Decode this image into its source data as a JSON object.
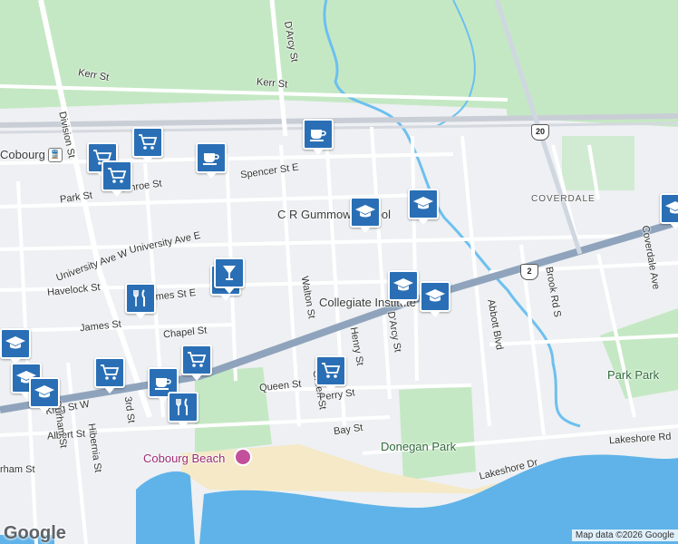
{
  "colors": {
    "water": "#5fb3e8",
    "park": "#c5e8c4",
    "road_major": "#8fa4bc",
    "pin": "#2a6fb5",
    "river": "#6cc0ef"
  },
  "labels": {
    "cobourg": "Cobourg",
    "kerr_st": "Kerr St",
    "darcy_st_n": "D'Arcy St",
    "division_st": "Division St",
    "spencer_st_e": "Spencer St E",
    "park_st": "Park St",
    "munroe_st": "Munroe St",
    "university_ave_e": "University Ave E",
    "university_ave_w": "University Ave W",
    "havelock_st": "Havelock St",
    "james_st_e": "James St E",
    "james_st": "James St",
    "chapel_st": "Chapel St",
    "walton_st": "Walton St",
    "henry_st": "Henry St",
    "darcy_st_s": "D'Arcy St",
    "abbott_blvd": "Abbott Blvd",
    "brook_rd_s": "Brook Rd S",
    "coverdale_ave": "Coverdale Ave",
    "coverdale": "COVERDALE",
    "queen_st": "Queen St",
    "green_st": "Green St",
    "perry_st": "Perry St",
    "bay_st": "Bay St",
    "king_st_w": "King St W",
    "albert_st": "Albert St",
    "third_st": "3rd St",
    "durham_st": "Durham St",
    "hibernia_st": "Hibernia St",
    "durham_st2": "rham St",
    "lakeshore_rd": "Lakeshore Rd",
    "lakeshore_dr": "Lakeshore Dr",
    "cr_gummow_school": "C R Gummow School",
    "collegiate_institute": "Collegiate Institute",
    "donegan_park": "Donegan Park",
    "park_park": "Park Park",
    "cobourg_beach": "Cobourg Beach",
    "route_2": "2",
    "route_20": "20",
    "google": "Google",
    "attribution": "Map data ©2026 Google"
  },
  "pins": [
    {
      "type": "cafe"
    },
    {
      "type": "grocery"
    },
    {
      "type": "grocery"
    },
    {
      "type": "grocery"
    },
    {
      "type": "cafe"
    },
    {
      "type": "school"
    },
    {
      "type": "school"
    },
    {
      "type": "school"
    },
    {
      "type": "school"
    },
    {
      "type": "school"
    },
    {
      "type": "shopping"
    },
    {
      "type": "restaurant"
    },
    {
      "type": "school"
    },
    {
      "type": "school"
    },
    {
      "type": "school"
    },
    {
      "type": "grocery"
    },
    {
      "type": "grocery"
    },
    {
      "type": "cafe"
    },
    {
      "type": "restaurant"
    },
    {
      "type": "grocery"
    },
    {
      "type": "bar"
    }
  ]
}
